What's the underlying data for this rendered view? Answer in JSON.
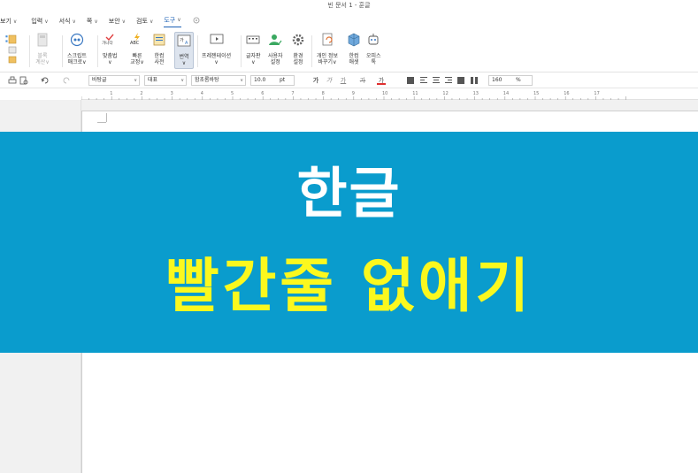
{
  "window": {
    "title": "빈 문서 1 - 훈글"
  },
  "menu": {
    "items": [
      {
        "label": "보기",
        "chev": "∨"
      },
      {
        "label": "입력",
        "chev": "∨"
      },
      {
        "label": "서식",
        "chev": "∨"
      },
      {
        "label": "쪽",
        "chev": "∨"
      },
      {
        "label": "보안",
        "chev": "∨"
      },
      {
        "label": "검토",
        "chev": "∨"
      },
      {
        "label": "도구",
        "chev": "∨"
      }
    ]
  },
  "ribbon": {
    "block_calc": {
      "l1": "블록",
      "l2": "계산∨"
    },
    "script_macro": {
      "l1": "스크립트",
      "l2": "매크로∨"
    },
    "spell": {
      "l1": "맞춤법",
      "l2": "∨",
      "glyph": "가나다"
    },
    "quick_fix": {
      "l1": "빠른",
      "l2": "교정∨",
      "glyph": "ABC"
    },
    "edit_dict": {
      "l1": "한컴",
      "l2": "사전"
    },
    "translate": {
      "l1": "번역",
      "l2": "∨"
    },
    "presentation": {
      "l1": "프레젠테이션",
      "l2": "∨"
    },
    "font_box": {
      "l1": "글자판",
      "l2": "∨"
    },
    "user_settings": {
      "l1": "사용자",
      "l2": "설정"
    },
    "env_settings": {
      "l1": "환경",
      "l2": "설정"
    },
    "personal_info": {
      "l1": "개인 정보",
      "l2": "바꾸기∨"
    },
    "hancom_asset": {
      "l1": "한컴",
      "l2": "애셋"
    },
    "office_tok": {
      "l1": "오피스",
      "l2": "톡"
    }
  },
  "format": {
    "style": "바탕글",
    "representative": "대표",
    "font": "함초롬바탕",
    "size": "10.0",
    "unit": "pt",
    "bold": "가",
    "italic": "가",
    "underline": "가",
    "strike": "가",
    "color": "가",
    "zoom": "160",
    "zoom_unit": "%"
  },
  "ruler": {
    "numbers": [
      "1",
      "2",
      "3",
      "4",
      "5",
      "6",
      "7",
      "8",
      "9",
      "10",
      "11",
      "12",
      "13",
      "14",
      "15",
      "16",
      "17"
    ]
  },
  "banner": {
    "title": "한글",
    "subtitle": "빨간줄  없애기",
    "title_color": "#ffffff",
    "subtitle_color": "#fbf81e",
    "background": "#0a9ccd"
  }
}
